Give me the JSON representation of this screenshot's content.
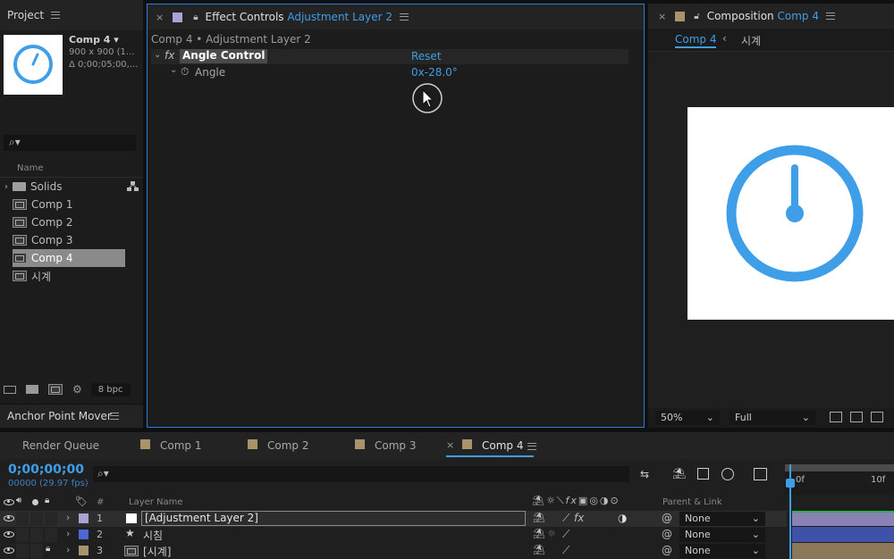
{
  "project": {
    "tab": "Project",
    "thumb": {
      "name": "Comp 4 ▾",
      "line1": "900 x 900 (1...",
      "line2": "Δ 0;00;05;00,..."
    },
    "search_icon_text": "⌕▾",
    "column": "Name",
    "items": [
      {
        "label": "Solids",
        "type": "folder"
      },
      {
        "label": "Comp 1",
        "type": "comp"
      },
      {
        "label": "Comp 2",
        "type": "comp"
      },
      {
        "label": "Comp 3",
        "type": "comp"
      },
      {
        "label": "Comp 4",
        "type": "comp",
        "selected": true
      },
      {
        "label": "시계",
        "type": "comp"
      }
    ],
    "bpc": "8 bpc"
  },
  "anchor_point_mover": {
    "tab": "Anchor Point Mover"
  },
  "effect_controls": {
    "tab_prefix": "Effect Controls",
    "tab_layer": "Adjustment Layer 2",
    "breadcrumb": "Comp 4 • Adjustment Layer 2",
    "fx_label": "fx",
    "effect_name": "Angle Control",
    "reset": "Reset",
    "param_name": "Angle",
    "param_value": "0x-28.0°"
  },
  "composition": {
    "tab_prefix": "Composition",
    "tab_comp": "Comp 4",
    "subtab_active": "Comp 4",
    "subtab_other": "시계",
    "zoom": "50%",
    "resolution": "Full",
    "clock_color": "#3f9ee8"
  },
  "timeline": {
    "tabs": [
      {
        "label": "Render Queue",
        "swatch": false
      },
      {
        "label": "Comp 1",
        "swatch": true
      },
      {
        "label": "Comp 2",
        "swatch": true
      },
      {
        "label": "Comp 3",
        "swatch": true
      },
      {
        "label": "Comp 4",
        "swatch": true,
        "active": true
      }
    ],
    "timecode": "0;00;00;00",
    "frames": "00000 (29.97 fps)",
    "col_layer_name": "Layer Name",
    "col_parent": "Parent & Link",
    "col_num": "#",
    "ruler": {
      "start": "0f",
      "mark": "10f"
    },
    "layers": [
      {
        "num": "1",
        "name": "[Adjustment Layer 2]",
        "color": "#a8a3d4",
        "parent": "None",
        "selected": true,
        "icon": "solid"
      },
      {
        "num": "2",
        "name": "시침",
        "color": "#4f66d6",
        "parent": "None",
        "icon": "star"
      },
      {
        "num": "3",
        "name": "[시계]",
        "color": "#a8936a",
        "parent": "None",
        "icon": "comp",
        "locked": true
      }
    ]
  }
}
